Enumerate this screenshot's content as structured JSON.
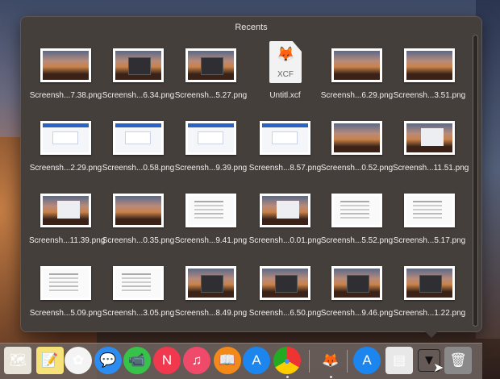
{
  "popup": {
    "title": "Recents"
  },
  "items": [
    {
      "name": "Screensh...7.38.png",
      "thumb": "desert"
    },
    {
      "name": "Screensh...6.34.png",
      "thumb": "dark"
    },
    {
      "name": "Screensh...5.27.png",
      "thumb": "dark"
    },
    {
      "name": "Untitl.xcf",
      "thumb": "xcf",
      "ext": "XCF"
    },
    {
      "name": "Screensh...6.29.png",
      "thumb": "desert"
    },
    {
      "name": "Screensh...3.51.png",
      "thumb": "desert"
    },
    {
      "name": "Screensh...2.29.png",
      "thumb": "web"
    },
    {
      "name": "Screensh...0.58.png",
      "thumb": "web"
    },
    {
      "name": "Screensh...9.39.png",
      "thumb": "web"
    },
    {
      "name": "Screensh...8.57.png",
      "thumb": "web"
    },
    {
      "name": "Screensh...0.52.png",
      "thumb": "desert"
    },
    {
      "name": "Screensh...11.51.png",
      "thumb": "panel"
    },
    {
      "name": "Screensh...11.39.png",
      "thumb": "panel"
    },
    {
      "name": "Screensh...0.35.png",
      "thumb": "desert"
    },
    {
      "name": "Screensh...9.41.png",
      "thumb": "doc"
    },
    {
      "name": "Screensh...0.01.png",
      "thumb": "panel"
    },
    {
      "name": "Screensh...5.52.png",
      "thumb": "doc"
    },
    {
      "name": "Screensh...5.17.png",
      "thumb": "doc"
    },
    {
      "name": "Screensh...5.09.png",
      "thumb": "doc"
    },
    {
      "name": "Screensh...3.05.png",
      "thumb": "doc"
    },
    {
      "name": "Screensh...8.49.png",
      "thumb": "dark"
    },
    {
      "name": "Screensh...6.50.png",
      "thumb": "dark"
    },
    {
      "name": "Screensh...9.46.png",
      "thumb": "dark"
    },
    {
      "name": "Screensh...1.22.png",
      "thumb": "dark"
    }
  ],
  "dock": [
    {
      "id": "maps",
      "icon": "maps-icon",
      "glyph": "🗺",
      "bg": "#e8e4da",
      "running": false
    },
    {
      "id": "notes",
      "icon": "notes-icon",
      "glyph": "📝",
      "bg": "#f7e27a",
      "running": false
    },
    {
      "id": "photos",
      "icon": "photos-icon",
      "glyph": "✿",
      "bg": "#f4f4f4",
      "running": false
    },
    {
      "id": "messages",
      "icon": "messages-icon",
      "glyph": "💬",
      "bg": "#2d8cf0",
      "running": false
    },
    {
      "id": "facetime",
      "icon": "facetime-icon",
      "glyph": "📹",
      "bg": "#37c24a",
      "running": false
    },
    {
      "id": "news",
      "icon": "news-icon",
      "glyph": "N",
      "bg": "#f0384f",
      "running": false
    },
    {
      "id": "music",
      "icon": "music-icon",
      "glyph": "♫",
      "bg": "#f04a6a",
      "running": false
    },
    {
      "id": "books",
      "icon": "books-icon",
      "glyph": "📖",
      "bg": "#f28a1a",
      "running": false
    },
    {
      "id": "app-store",
      "icon": "app-store-icon",
      "glyph": "A",
      "bg": "#1c86ee",
      "running": false
    },
    {
      "id": "chrome",
      "icon": "chrome-icon",
      "glyph": "●",
      "bg": "conic-gradient(#e33 0 120deg,#fc0 0 240deg,#2a2 0)",
      "running": true
    },
    {
      "id": "gimp",
      "icon": "gimp-icon",
      "glyph": "🦊",
      "bg": "transparent",
      "running": true
    },
    {
      "id": "applications",
      "icon": "applications-folder-icon",
      "glyph": "A",
      "bg": "#1c86ee",
      "running": false
    },
    {
      "id": "downloads",
      "icon": "downloads-icon",
      "glyph": "▤",
      "bg": "#e8e8e8",
      "running": false
    },
    {
      "id": "recents-stack",
      "icon": "stack-arrow-icon",
      "glyph": "▼",
      "bg": "transparent",
      "running": false
    },
    {
      "id": "trash",
      "icon": "trash-icon",
      "glyph": "🗑",
      "bg": "#8a8a8a",
      "running": false
    }
  ]
}
